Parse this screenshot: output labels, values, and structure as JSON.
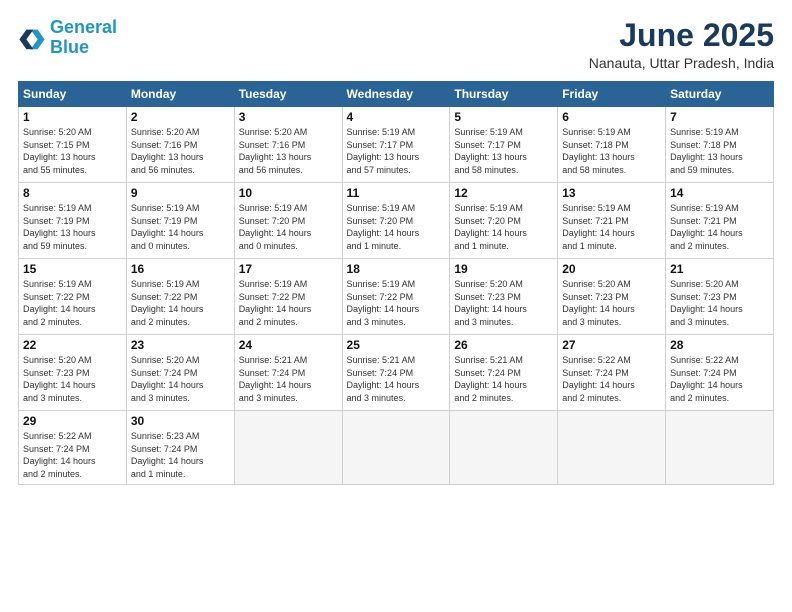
{
  "logo": {
    "line1": "General",
    "line2": "Blue"
  },
  "title": "June 2025",
  "subtitle": "Nanauta, Uttar Pradesh, India",
  "headers": [
    "Sunday",
    "Monday",
    "Tuesday",
    "Wednesday",
    "Thursday",
    "Friday",
    "Saturday"
  ],
  "weeks": [
    [
      {
        "day": "1",
        "lines": [
          "Sunrise: 5:20 AM",
          "Sunset: 7:15 PM",
          "Daylight: 13 hours",
          "and 55 minutes."
        ]
      },
      {
        "day": "2",
        "lines": [
          "Sunrise: 5:20 AM",
          "Sunset: 7:16 PM",
          "Daylight: 13 hours",
          "and 56 minutes."
        ]
      },
      {
        "day": "3",
        "lines": [
          "Sunrise: 5:20 AM",
          "Sunset: 7:16 PM",
          "Daylight: 13 hours",
          "and 56 minutes."
        ]
      },
      {
        "day": "4",
        "lines": [
          "Sunrise: 5:19 AM",
          "Sunset: 7:17 PM",
          "Daylight: 13 hours",
          "and 57 minutes."
        ]
      },
      {
        "day": "5",
        "lines": [
          "Sunrise: 5:19 AM",
          "Sunset: 7:17 PM",
          "Daylight: 13 hours",
          "and 58 minutes."
        ]
      },
      {
        "day": "6",
        "lines": [
          "Sunrise: 5:19 AM",
          "Sunset: 7:18 PM",
          "Daylight: 13 hours",
          "and 58 minutes."
        ]
      },
      {
        "day": "7",
        "lines": [
          "Sunrise: 5:19 AM",
          "Sunset: 7:18 PM",
          "Daylight: 13 hours",
          "and 59 minutes."
        ]
      }
    ],
    [
      {
        "day": "8",
        "lines": [
          "Sunrise: 5:19 AM",
          "Sunset: 7:19 PM",
          "Daylight: 13 hours",
          "and 59 minutes."
        ]
      },
      {
        "day": "9",
        "lines": [
          "Sunrise: 5:19 AM",
          "Sunset: 7:19 PM",
          "Daylight: 14 hours",
          "and 0 minutes."
        ]
      },
      {
        "day": "10",
        "lines": [
          "Sunrise: 5:19 AM",
          "Sunset: 7:20 PM",
          "Daylight: 14 hours",
          "and 0 minutes."
        ]
      },
      {
        "day": "11",
        "lines": [
          "Sunrise: 5:19 AM",
          "Sunset: 7:20 PM",
          "Daylight: 14 hours",
          "and 1 minute."
        ]
      },
      {
        "day": "12",
        "lines": [
          "Sunrise: 5:19 AM",
          "Sunset: 7:20 PM",
          "Daylight: 14 hours",
          "and 1 minute."
        ]
      },
      {
        "day": "13",
        "lines": [
          "Sunrise: 5:19 AM",
          "Sunset: 7:21 PM",
          "Daylight: 14 hours",
          "and 1 minute."
        ]
      },
      {
        "day": "14",
        "lines": [
          "Sunrise: 5:19 AM",
          "Sunset: 7:21 PM",
          "Daylight: 14 hours",
          "and 2 minutes."
        ]
      }
    ],
    [
      {
        "day": "15",
        "lines": [
          "Sunrise: 5:19 AM",
          "Sunset: 7:22 PM",
          "Daylight: 14 hours",
          "and 2 minutes."
        ]
      },
      {
        "day": "16",
        "lines": [
          "Sunrise: 5:19 AM",
          "Sunset: 7:22 PM",
          "Daylight: 14 hours",
          "and 2 minutes."
        ]
      },
      {
        "day": "17",
        "lines": [
          "Sunrise: 5:19 AM",
          "Sunset: 7:22 PM",
          "Daylight: 14 hours",
          "and 2 minutes."
        ]
      },
      {
        "day": "18",
        "lines": [
          "Sunrise: 5:19 AM",
          "Sunset: 7:22 PM",
          "Daylight: 14 hours",
          "and 3 minutes."
        ]
      },
      {
        "day": "19",
        "lines": [
          "Sunrise: 5:20 AM",
          "Sunset: 7:23 PM",
          "Daylight: 14 hours",
          "and 3 minutes."
        ]
      },
      {
        "day": "20",
        "lines": [
          "Sunrise: 5:20 AM",
          "Sunset: 7:23 PM",
          "Daylight: 14 hours",
          "and 3 minutes."
        ]
      },
      {
        "day": "21",
        "lines": [
          "Sunrise: 5:20 AM",
          "Sunset: 7:23 PM",
          "Daylight: 14 hours",
          "and 3 minutes."
        ]
      }
    ],
    [
      {
        "day": "22",
        "lines": [
          "Sunrise: 5:20 AM",
          "Sunset: 7:23 PM",
          "Daylight: 14 hours",
          "and 3 minutes."
        ]
      },
      {
        "day": "23",
        "lines": [
          "Sunrise: 5:20 AM",
          "Sunset: 7:24 PM",
          "Daylight: 14 hours",
          "and 3 minutes."
        ]
      },
      {
        "day": "24",
        "lines": [
          "Sunrise: 5:21 AM",
          "Sunset: 7:24 PM",
          "Daylight: 14 hours",
          "and 3 minutes."
        ]
      },
      {
        "day": "25",
        "lines": [
          "Sunrise: 5:21 AM",
          "Sunset: 7:24 PM",
          "Daylight: 14 hours",
          "and 3 minutes."
        ]
      },
      {
        "day": "26",
        "lines": [
          "Sunrise: 5:21 AM",
          "Sunset: 7:24 PM",
          "Daylight: 14 hours",
          "and 2 minutes."
        ]
      },
      {
        "day": "27",
        "lines": [
          "Sunrise: 5:22 AM",
          "Sunset: 7:24 PM",
          "Daylight: 14 hours",
          "and 2 minutes."
        ]
      },
      {
        "day": "28",
        "lines": [
          "Sunrise: 5:22 AM",
          "Sunset: 7:24 PM",
          "Daylight: 14 hours",
          "and 2 minutes."
        ]
      }
    ],
    [
      {
        "day": "29",
        "lines": [
          "Sunrise: 5:22 AM",
          "Sunset: 7:24 PM",
          "Daylight: 14 hours",
          "and 2 minutes."
        ]
      },
      {
        "day": "30",
        "lines": [
          "Sunrise: 5:23 AM",
          "Sunset: 7:24 PM",
          "Daylight: 14 hours",
          "and 1 minute."
        ]
      },
      null,
      null,
      null,
      null,
      null
    ]
  ]
}
